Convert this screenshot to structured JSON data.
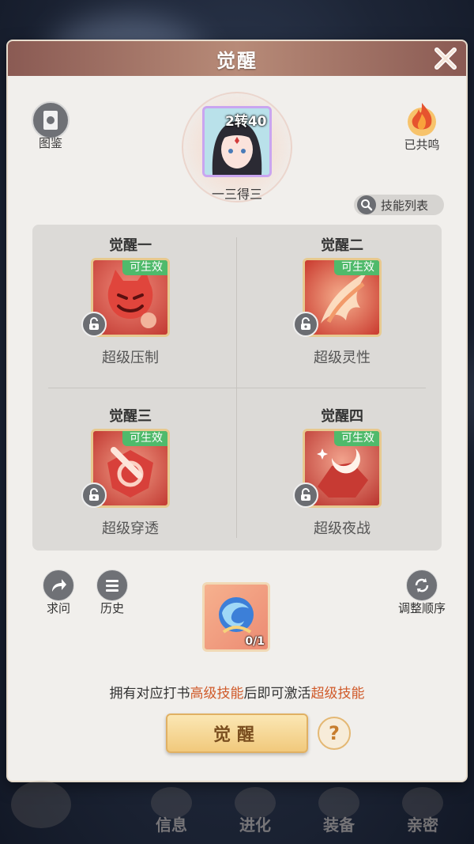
{
  "window": {
    "title": "觉醒"
  },
  "top": {
    "handbook_label": "图鉴",
    "resonated_label": "已共鸣",
    "hero_level": "2转40",
    "hero_name": "一三得三",
    "skill_list_label": "技能列表"
  },
  "awakenings": [
    {
      "title": "觉醒一",
      "badge": "可生效",
      "skill": "超级压制"
    },
    {
      "title": "觉醒二",
      "badge": "可生效",
      "skill": "超级灵性"
    },
    {
      "title": "觉醒三",
      "badge": "可生效",
      "skill": "超级穿透"
    },
    {
      "title": "觉醒四",
      "badge": "可生效",
      "skill": "超级夜战"
    }
  ],
  "actions": {
    "ask_label": "求问",
    "history_label": "历史",
    "reorder_label": "调整顺序",
    "item_count": "0/1"
  },
  "hint": {
    "part1": "拥有对应打书",
    "highlight1": "高级技能",
    "part2": "后即可激活",
    "highlight2": "超级技能"
  },
  "awaken_button_label": "觉醒",
  "help_label": "?",
  "bottom_nav": [
    {
      "label": "信息"
    },
    {
      "label": "进化"
    },
    {
      "label": "装备"
    },
    {
      "label": "亲密"
    }
  ],
  "colors": {
    "badge_green": "#4fba6b",
    "highlight_orange": "#d05a2a",
    "title_bar": "#8a5a53",
    "button_gold": "#f1c97c"
  }
}
